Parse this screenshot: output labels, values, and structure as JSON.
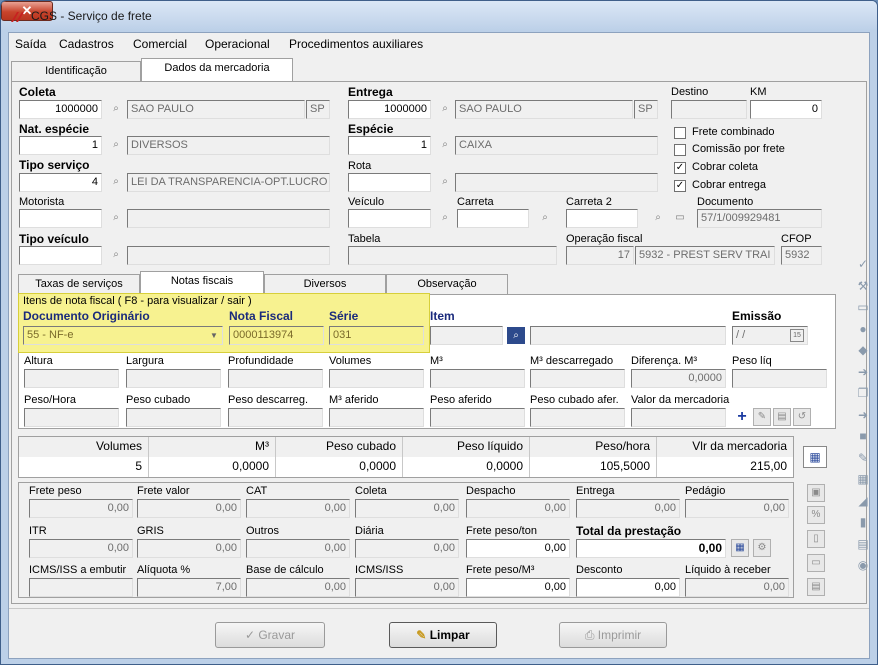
{
  "window": {
    "title": "CGS - Serviço de frete",
    "close_glyph": "✕"
  },
  "menu": [
    "Saída",
    "Cadastros",
    "Comercial",
    "Operacional",
    "Procedimentos auxiliares"
  ],
  "main_tabs": [
    "Identificação",
    "Dados da mercadoria"
  ],
  "coleta": {
    "label": "Coleta",
    "code": "1000000",
    "city": "SAO PAULO",
    "uf": "SP"
  },
  "entrega": {
    "label": "Entrega",
    "code": "1000000",
    "city": "SAO PAULO",
    "uf": "SP"
  },
  "destino": {
    "label": "Destino",
    "value": ""
  },
  "km": {
    "label": "KM",
    "value": "0"
  },
  "nat_especie": {
    "label": "Nat. espécie",
    "code": "1",
    "desc": "DIVERSOS"
  },
  "especie": {
    "label": "Espécie",
    "code": "1",
    "desc": "CAIXA"
  },
  "tipo_servico": {
    "label": "Tipo serviço",
    "code": "4",
    "desc": "LEI DA TRANSPARENCIA-OPT.LUCRO"
  },
  "rota": {
    "label": "Rota"
  },
  "motorista": {
    "label": "Motorista"
  },
  "veiculo": {
    "label": "Veículo"
  },
  "carreta": {
    "label": "Carreta"
  },
  "carreta2": {
    "label": "Carreta 2"
  },
  "documento": {
    "label": "Documento",
    "value": "57/1/009929481"
  },
  "tipo_veiculo": {
    "label": "Tipo veículo"
  },
  "tabela": {
    "label": "Tabela"
  },
  "operacao_fiscal": {
    "label": "Operação fiscal",
    "code": "17",
    "desc": "5932 - PREST SERV TRAI"
  },
  "cfop": {
    "label": "CFOP",
    "value": "5932"
  },
  "checks": {
    "frete_combinado": "Frete combinado",
    "comissao": "Comissão por frete",
    "cobrar_coleta": "Cobrar coleta",
    "cobrar_entrega": "Cobrar entrega",
    "check_glyph": "✓"
  },
  "sub_tabs": [
    "Taxas de serviços",
    "Notas fiscais",
    "Diversos",
    "Observação"
  ],
  "nf": {
    "group_title": "Itens de nota fiscal ( F8 - para visualizar / sair )",
    "doc_origem_label": "Documento Originário",
    "doc_origem_value": "55 - NF-e",
    "nota_label": "Nota Fiscal",
    "nota_value": "0000113974",
    "serie_label": "Série",
    "serie_value": "031",
    "item_label": "Item",
    "emissao_label": "Emissão",
    "emissao_value": " / /",
    "labels1": [
      "Altura",
      "Largura",
      "Profundidade",
      "Volumes",
      "M³",
      "M³ descarregado",
      "Diferença. M³",
      "Peso líq"
    ],
    "diferenca_value": "0,0000",
    "labels2": [
      "Peso/Hora",
      "Peso cubado",
      "Peso descarreg.",
      "M³ aferido",
      "Peso aferido",
      "Peso cubado afer.",
      "Valor da mercadoria"
    ],
    "add_glyph": "+"
  },
  "totals": {
    "headers": [
      "Volumes",
      "M³",
      "Peso cubado",
      "Peso líquido",
      "Peso/hora",
      "Vlr da mercadoria"
    ],
    "values": [
      "5",
      "0,0000",
      "0,0000",
      "0,0000",
      "105,5000",
      "215,00"
    ]
  },
  "freight": {
    "row1": [
      {
        "l": "Frete peso",
        "v": "0,00"
      },
      {
        "l": "Frete valor",
        "v": "0,00"
      },
      {
        "l": "CAT",
        "v": "0,00"
      },
      {
        "l": "Coleta",
        "v": "0,00"
      },
      {
        "l": "Despacho",
        "v": "0,00"
      },
      {
        "l": "Entrega",
        "v": "0,00"
      },
      {
        "l": "Pedágio",
        "v": "0,00"
      }
    ],
    "row2": [
      {
        "l": "ITR",
        "v": "0,00"
      },
      {
        "l": "GRIS",
        "v": "0,00"
      },
      {
        "l": "Outros",
        "v": "0,00"
      },
      {
        "l": "Diária",
        "v": "0,00"
      },
      {
        "l": "Frete peso/ton",
        "v": "0,00"
      }
    ],
    "total_label": "Total da prestação",
    "total_value": "0,00",
    "row3": [
      {
        "l": "ICMS/ISS a embutir",
        "v": ""
      },
      {
        "l": "Alíquota %",
        "v": "7,00"
      },
      {
        "l": "Base de cálculo",
        "v": "0,00"
      },
      {
        "l": "ICMS/ISS",
        "v": "0,00"
      },
      {
        "l": "Frete peso/M³",
        "v": "0,00"
      },
      {
        "l": "Desconto",
        "v": "0,00"
      },
      {
        "l": "Líquido à receber",
        "v": "0,00"
      }
    ]
  },
  "buttons": {
    "gravar": "Gravar",
    "limpar": "Limpar",
    "imprimir": "Imprimir"
  }
}
